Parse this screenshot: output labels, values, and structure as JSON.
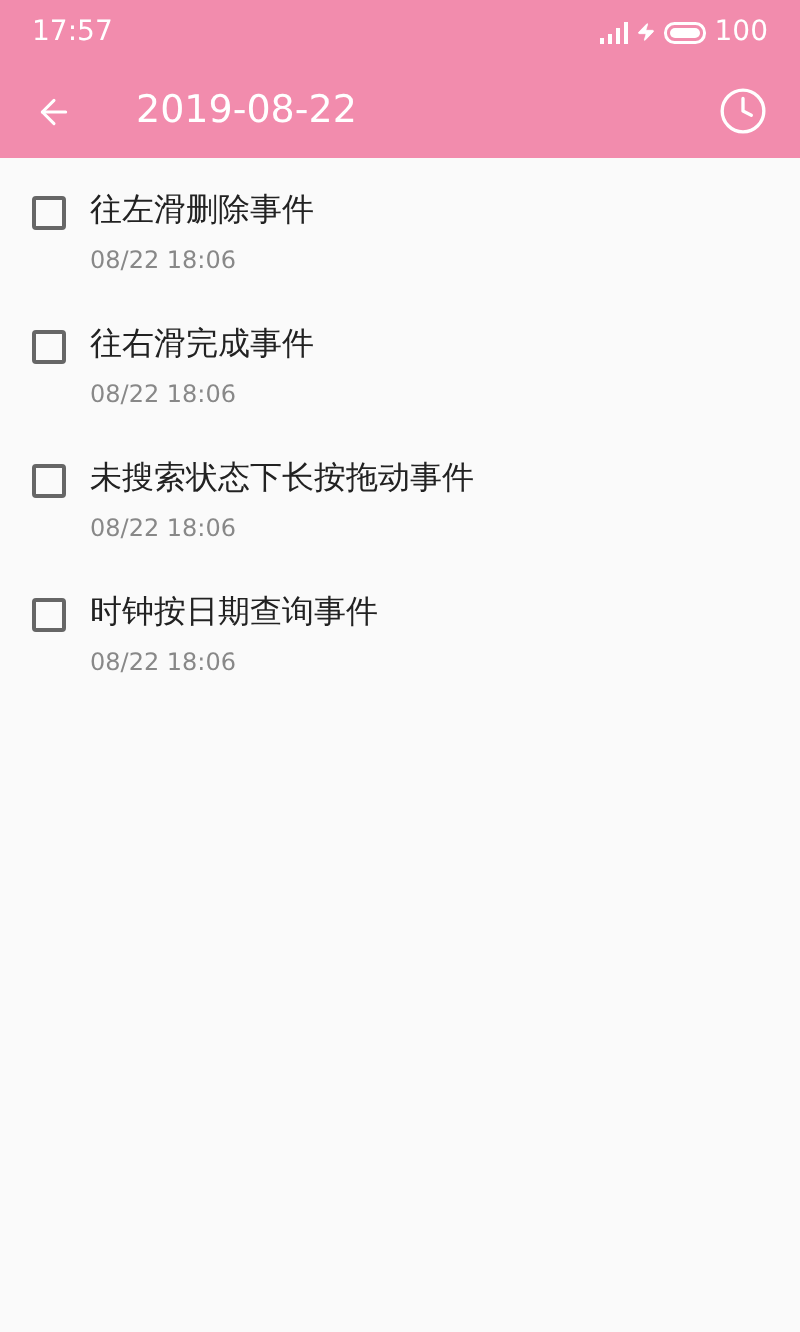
{
  "status_bar": {
    "time": "17:57",
    "battery": "100"
  },
  "header": {
    "title": "2019-08-22"
  },
  "events": [
    {
      "title": "往左滑删除事件",
      "time": "08/22 18:06",
      "checked": false
    },
    {
      "title": "往右滑完成事件",
      "time": "08/22 18:06",
      "checked": false
    },
    {
      "title": "未搜索状态下长按拖动事件",
      "time": "08/22 18:06",
      "checked": false
    },
    {
      "title": "时钟按日期查询事件",
      "time": "08/22 18:06",
      "checked": false
    }
  ]
}
